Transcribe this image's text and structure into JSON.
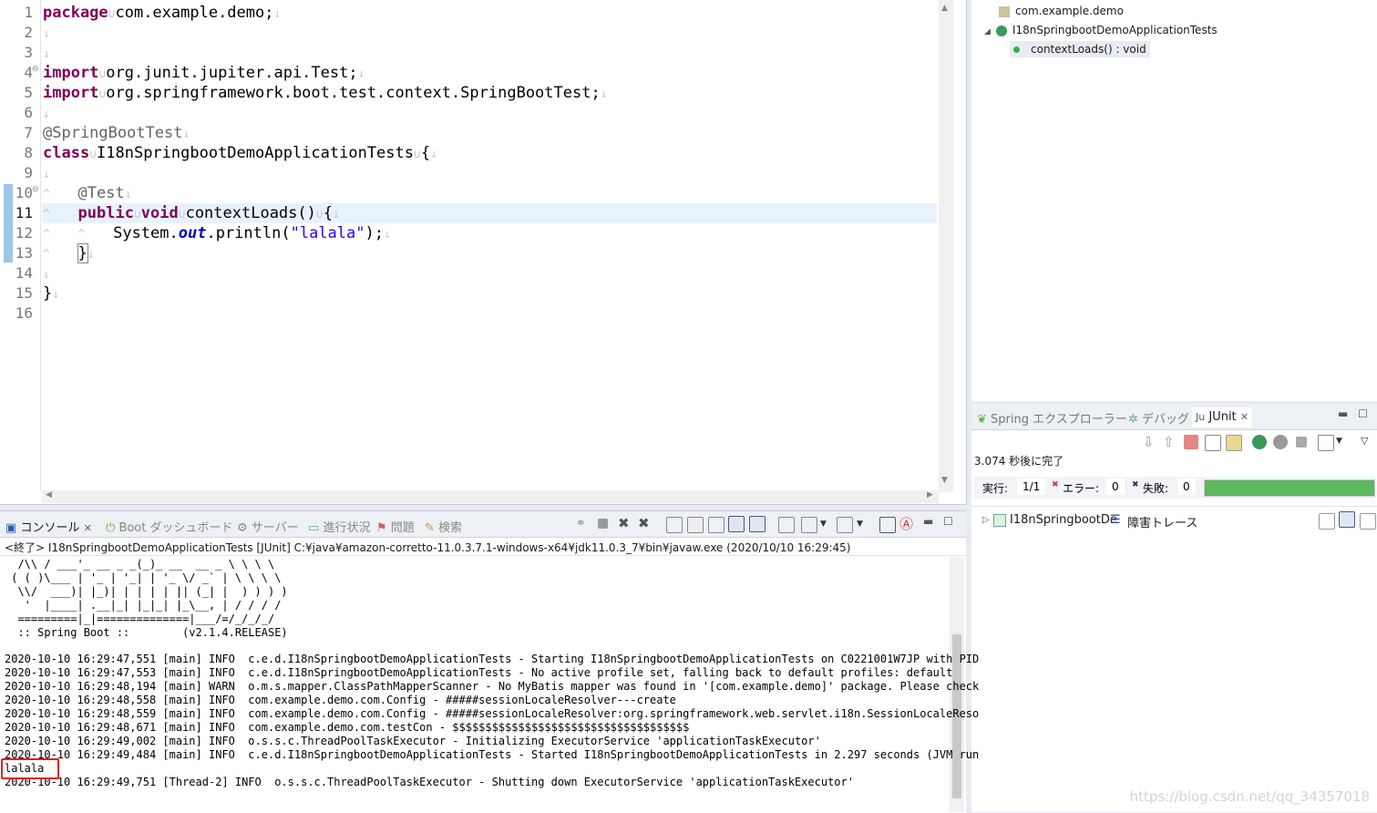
{
  "editor": {
    "line_numbers": [
      "1",
      "2",
      "3",
      "4",
      "5",
      "6",
      "7",
      "8",
      "9",
      "10",
      "11",
      "12",
      "13",
      "14",
      "15",
      "16"
    ],
    "l1_kw": "package",
    "l1_rest": "com.example.demo;",
    "l4_kw": "import",
    "l4_rest": "org.junit.jupiter.api.Test;",
    "l5_kw": "import",
    "l5_rest": "org.springframework.boot.test.context.SpringBootTest;",
    "l7_ann": "@SpringBootTest",
    "l8_kw": "class",
    "l8_rest": "I18nSpringbootDemoApplicationTests",
    "l8_brace": "{",
    "l10_ann": "@Test",
    "l11_kw1": "public",
    "l11_kw2": "void",
    "l11_rest": "contextLoads()",
    "l11_brace": "{",
    "l12_pre": "System.",
    "l12_field": "out",
    "l12_mid": ".println(",
    "l12_str": "\"lalala\"",
    "l12_end": ");",
    "l13_brace": "}",
    "l15_brace": "}",
    "space_glyph": "∪",
    "eol_glyph": "↓",
    "tab_glyph": "^"
  },
  "outline": {
    "package": "com.example.demo",
    "class": "I18nSpringbootDemoApplicationTests",
    "method": "contextLoads() : void"
  },
  "junit": {
    "tabs": [
      "Spring エクスプローラー",
      "デバッグ",
      "JUnit"
    ],
    "status": "3.074 秒後に完了",
    "runs_label": "実行:",
    "runs_value": "1/1",
    "errors_label": "エラー:",
    "errors_value": "0",
    "failures_label": "失敗:",
    "failures_value": "0",
    "progress_fraction": 1.0,
    "progress_color": "#5cb85c",
    "tree_item": "I18nSpringbootDe",
    "trace_label": "障害トレース"
  },
  "console": {
    "tabs": [
      "コンソール",
      "Boot ダッシュボード",
      "サーバー",
      "進行状況",
      "問題",
      "検索"
    ],
    "header": "<終了> I18nSpringbootDemoApplicationTests [JUnit] C:¥java¥amazon-corretto-11.0.3.7.1-windows-x64¥jdk11.0.3_7¥bin¥javaw.exe (2020/10/10 16:29:45)",
    "lines": [
      "  /\\\\ / ___'_ __ _ _(_)_ __  __ _ \\ \\ \\ \\",
      " ( ( )\\___ | '_ | '_| | '_ \\/ _` | \\ \\ \\ \\",
      "  \\\\/  ___)| |_)| | | | | || (_| |  ) ) ) )",
      "   '  |____| .__|_| |_|_| |_\\__, | / / / /",
      "  =========|_|==============|___/=/_/_/_/",
      "  :: Spring Boot ::        (v2.1.4.RELEASE)",
      "",
      "2020-10-10 16:29:47,551 [main] INFO  c.e.d.I18nSpringbootDemoApplicationTests - Starting I18nSpringbootDemoApplicationTests on C0221001W7JP with PID",
      "2020-10-10 16:29:47,553 [main] INFO  c.e.d.I18nSpringbootDemoApplicationTests - No active profile set, falling back to default profiles: default",
      "2020-10-10 16:29:48,194 [main] WARN  o.m.s.mapper.ClassPathMapperScanner - No MyBatis mapper was found in '[com.example.demo]' package. Please check",
      "2020-10-10 16:29:48,558 [main] INFO  com.example.demo.com.Config - #####sessionLocaleResolver---create",
      "2020-10-10 16:29:48,559 [main] INFO  com.example.demo.com.Config - #####sessionLocaleResolver:org.springframework.web.servlet.i18n.SessionLocaleReso",
      "2020-10-10 16:29:48,671 [main] INFO  com.example.demo.com.testCon - $$$$$$$$$$$$$$$$$$$$$$$$$$$$$$$$$$$$",
      "2020-10-10 16:29:49,002 [main] INFO  o.s.s.c.ThreadPoolTaskExecutor - Initializing ExecutorService 'applicationTaskExecutor'",
      "2020-10-10 16:29:49,484 [main] INFO  c.e.d.I18nSpringbootDemoApplicationTests - Started I18nSpringbootDemoApplicationTests in 2.297 seconds (JVM run",
      "lalala",
      "2020-10-10 16:29:49,751 [Thread-2] INFO  o.s.s.c.ThreadPoolTaskExecutor - Shutting down ExecutorService 'applicationTaskExecutor'"
    ]
  },
  "watermark": "https://blog.csdn.net/qq_34357018"
}
